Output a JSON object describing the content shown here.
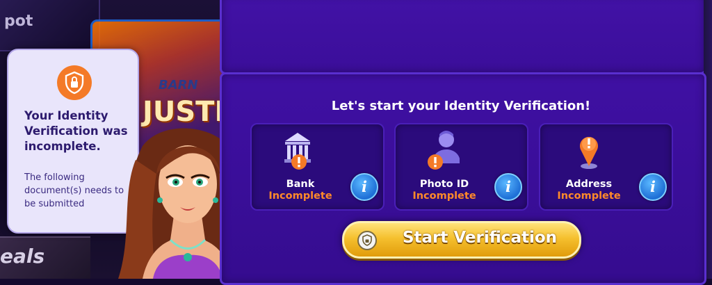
{
  "background": {
    "tile1_text": "pot",
    "tile2_brand": "BARN",
    "tile2_title": "JUSTIC",
    "tile3_text": "eals"
  },
  "info_card": {
    "icon": "shield-lock-icon",
    "title": "Your Identity Verification was incomplete.",
    "subtitle": "The following document(s) needs to be submitted"
  },
  "panel": {
    "title": "Let's start your Identity Verification!",
    "documents": [
      {
        "name": "Bank",
        "status": "Incomplete",
        "icon": "bank-icon"
      },
      {
        "name": "Photo ID",
        "status": "Incomplete",
        "icon": "photo-id-icon"
      },
      {
        "name": "Address",
        "status": "Incomplete",
        "icon": "location-pin-icon"
      }
    ],
    "info_button_label": "i",
    "start_button_label": "Start Verification"
  },
  "colors": {
    "panel_purple": "#3f10a3",
    "status_orange": "#ff8a2a",
    "button_gold": "#f5c02e",
    "info_blue": "#1e6fd6",
    "badge_orange": "#f47a27"
  }
}
